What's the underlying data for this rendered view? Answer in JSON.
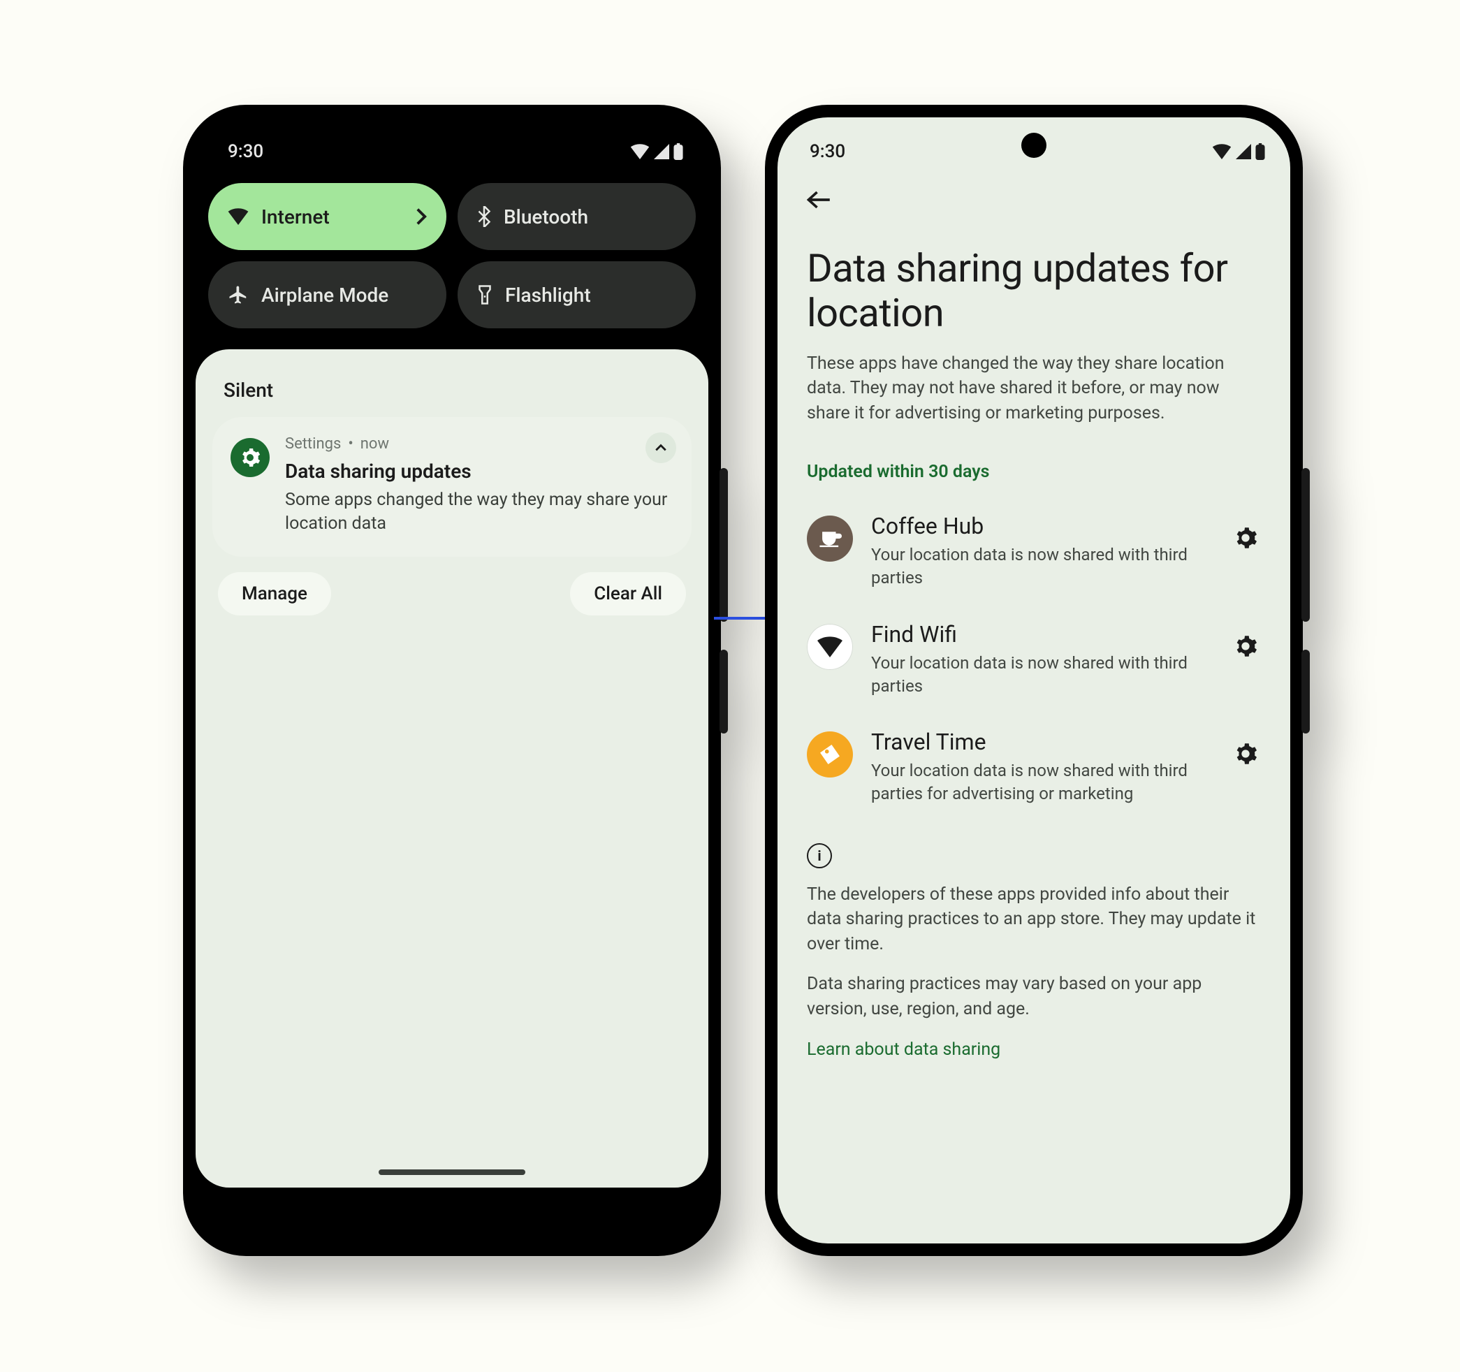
{
  "status": {
    "time": "9:30"
  },
  "quick_settings": {
    "internet": "Internet",
    "bluetooth": "Bluetooth",
    "airplane": "Airplane Mode",
    "flashlight": "Flashlight"
  },
  "shade": {
    "silent_label": "Silent",
    "notification": {
      "app": "Settings",
      "time": "now",
      "title": "Data sharing updates",
      "text": "Some apps changed the way they may share your location data"
    },
    "manage": "Manage",
    "clear_all": "Clear All"
  },
  "page": {
    "title": "Data sharing updates for location",
    "description": "These apps have changed the way they share location data. They may not have shared it before, or may now share it for advertising or marketing purposes.",
    "section_label": "Updated within 30 days",
    "apps": [
      {
        "name": "Coffee Hub",
        "sub": "Your location data is now shared with third parties"
      },
      {
        "name": "Find Wifi",
        "sub": "Your location data is now shared with third parties"
      },
      {
        "name": "Travel Time",
        "sub": "Your location data is now shared with third parties for advertising or marketing"
      }
    ],
    "info1": "The developers of these apps provided info about their data sharing practices to an app store. They may update it over time.",
    "info2": "Data sharing practices may vary based on your app version, use, region, and age.",
    "learn": "Learn about data sharing"
  }
}
